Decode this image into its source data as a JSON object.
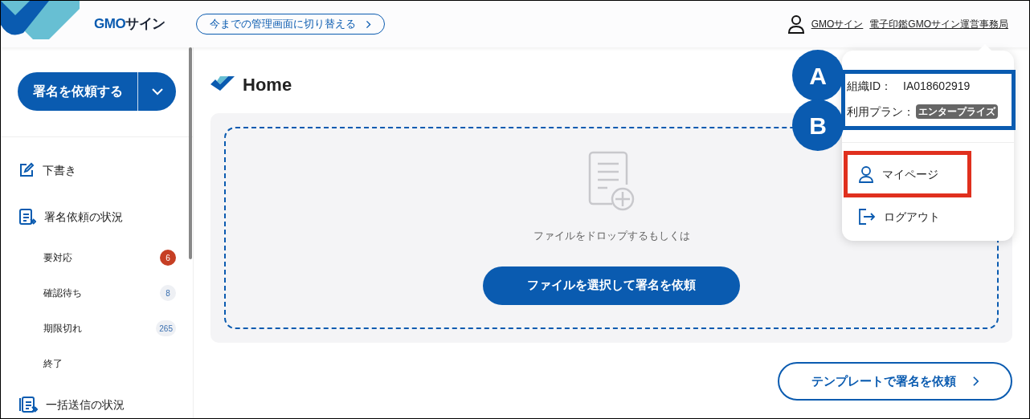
{
  "header": {
    "logo_primary": "GMO",
    "logo_secondary": "サイン",
    "switch_button": "今までの管理画面に切り替える",
    "user_links": [
      "GMOサイン",
      "電子印鑑GMOサイン運営事務局"
    ]
  },
  "sidebar": {
    "primary_button": "署名を依頼する",
    "items": [
      {
        "label": "下書き"
      },
      {
        "label": "署名依頼の状況",
        "children": [
          {
            "label": "要対応",
            "badge": "6",
            "kind": "alert"
          },
          {
            "label": "確認待ち",
            "badge": "8",
            "kind": "count"
          },
          {
            "label": "期限切れ",
            "badge": "265",
            "kind": "count"
          },
          {
            "label": "終了"
          }
        ]
      },
      {
        "label": "一括送信の状況"
      }
    ]
  },
  "main": {
    "title": "Home",
    "drop_hint": "ファイルをドロップするもしくは",
    "select_button": "ファイルを選択して署名を依頼",
    "template_button": "テンプレートで署名を依頼"
  },
  "account_menu": {
    "org_label": "組織ID：",
    "org_id": "IA018602919",
    "plan_label": "利用プラン：",
    "plan_badge": "エンタープライズ",
    "items": [
      {
        "label": "マイページ",
        "highlighted": true
      },
      {
        "label": "ログアウト",
        "highlighted": false
      }
    ]
  },
  "callouts": [
    "A",
    "B"
  ]
}
